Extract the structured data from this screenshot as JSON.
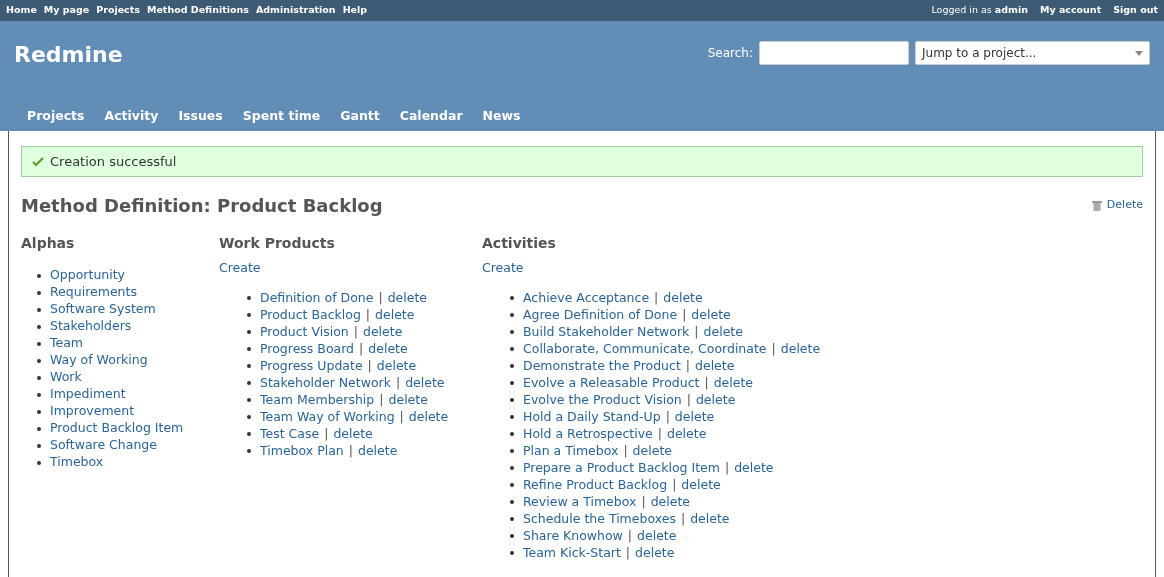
{
  "top_menu": {
    "left": [
      "Home",
      "My page",
      "Projects",
      "Method Definitions",
      "Administration",
      "Help"
    ],
    "logged_in": "Logged in as **admin**",
    "right": [
      "My account",
      "Sign out"
    ]
  },
  "header": {
    "title": "Redmine",
    "search_label": "Search:",
    "jump": "Jump to a project..."
  },
  "main_menu": [
    "Projects",
    "Activity",
    "Issues",
    "Spent time",
    "Gantt",
    "Calendar",
    "News"
  ],
  "flash": {
    "kind": "notice",
    "text": "Creation successful"
  },
  "page": {
    "title": "Method Definition: Product Backlog",
    "delete": "Delete"
  },
  "alphas": {
    "title": "Alphas",
    "items": [
      "Opportunity",
      "Requirements",
      "Software System",
      "Stakeholders",
      "Team",
      "Way of Working",
      "Work",
      "Impediment",
      "Improvement",
      "Product Backlog Item",
      "Software Change",
      "Timebox"
    ]
  },
  "work_products": {
    "title": "Work Products",
    "create": "Create",
    "items": [
      {
        "name": "Definition of Done",
        "separator": "|",
        "action": "delete"
      },
      {
        "name": "Product Backlog",
        "separator": "|",
        "action": "delete"
      },
      {
        "name": "Product Vision",
        "separator": "|",
        "action": "delete"
      },
      {
        "name": "Progress Board",
        "separator": "|",
        "action": "delete"
      },
      {
        "name": "Progress Update",
        "separator": "|",
        "action": "delete"
      },
      {
        "name": "Stakeholder Network",
        "separator": "|",
        "action": "delete"
      },
      {
        "name": "Team Membership",
        "separator": "|",
        "action": "delete"
      },
      {
        "name": "Team Way of Working",
        "separator": "|",
        "action": "delete"
      },
      {
        "name": "Test Case",
        "separator": "|",
        "action": "delete"
      },
      {
        "name": "Timebox Plan",
        "separator": "|",
        "action": "delete"
      }
    ]
  },
  "activities": {
    "title": "Activities",
    "create": "Create",
    "items": [
      {
        "name": "Achieve Acceptance",
        "separator": "|",
        "action": "delete"
      },
      {
        "name": "Agree Definition of Done",
        "separator": "|",
        "action": "delete"
      },
      {
        "name": "Build Stakeholder Network",
        "separator": "|",
        "action": "delete"
      },
      {
        "name": "Collaborate, Communicate, Coordinate",
        "separator": "|",
        "action": "delete"
      },
      {
        "name": "Demonstrate the Product",
        "separator": "|",
        "action": "delete"
      },
      {
        "name": "Evolve a Releasable Product",
        "separator": "|",
        "action": "delete"
      },
      {
        "name": "Evolve the Product Vision",
        "separator": "|",
        "action": "delete"
      },
      {
        "name": "Hold a Daily Stand-Up",
        "separator": "|",
        "action": "delete"
      },
      {
        "name": "Hold a Retrospective",
        "separator": "|",
        "action": "delete"
      },
      {
        "name": "Plan a Timebox",
        "separator": "|",
        "action": "delete"
      },
      {
        "name": "Prepare a Product Backlog Item",
        "separator": "|",
        "action": "delete"
      },
      {
        "name": "Refine Product Backlog",
        "separator": "|",
        "action": "delete"
      },
      {
        "name": "Review a Timebox",
        "separator": "|",
        "action": "delete"
      },
      {
        "name": "Schedule the Timeboxes",
        "separator": "|",
        "action": "delete"
      },
      {
        "name": "Share Knowhow",
        "separator": "|",
        "action": "delete"
      },
      {
        "name": "Team Kick-Start",
        "separator": "|",
        "action": "delete"
      }
    ]
  }
}
